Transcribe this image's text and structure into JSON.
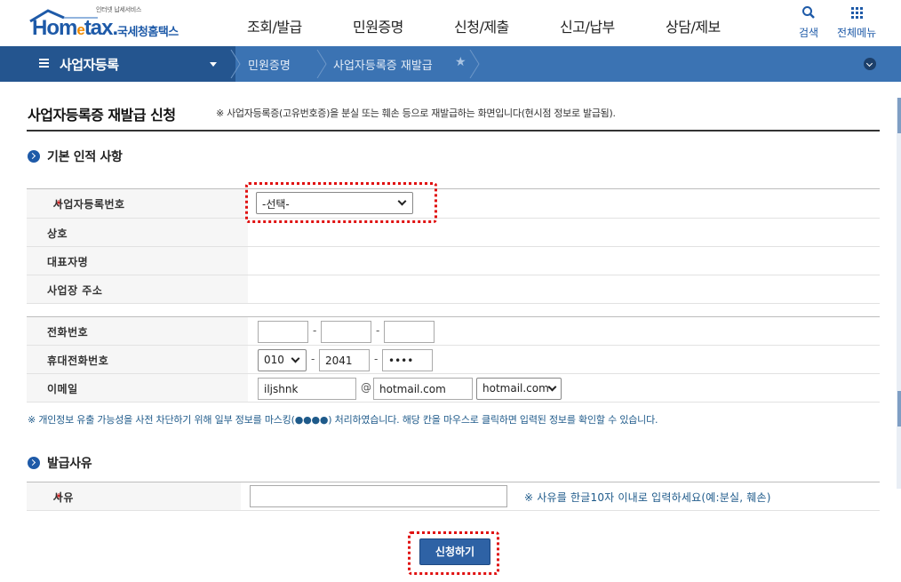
{
  "header": {
    "logo_tagline": "인터넷 납세서비스",
    "logo_word_a": "Hom",
    "logo_word_e": "e",
    "logo_word_b": "tax",
    "logo_suffix": ".",
    "logo_kr": "국세청홈택스",
    "nav": [
      "조회/발급",
      "민원증명",
      "신청/제출",
      "신고/납부",
      "상담/제보"
    ],
    "search_label": "검색",
    "allmenu_label": "전체메뉴"
  },
  "subnav": {
    "main_title": "사업자등록",
    "crumb1": "민원증명",
    "crumb2": "사업자등록증 재발급"
  },
  "page": {
    "title": "사업자등록증 재발급 신청",
    "desc": "※ 사업자등록증(고유번호증)을 분실 또는 훼손 등으로 재발급하는 화면입니다(현시점 정보로 발급됨)."
  },
  "section1": {
    "title": "기본 인적 사항",
    "req_mark": "*",
    "biz_no_label": "사업자등록번호",
    "biz_no_select": "-선택-",
    "company_label": "상호",
    "ceo_label": "대표자명",
    "address_label": "사업장 주소",
    "phone_label": "전화번호",
    "phone1": "",
    "phone2": "",
    "phone3": "",
    "mobile_label": "휴대전화번호",
    "mobile1": "010",
    "mobile2": "2041",
    "mobile3": "••••",
    "email_label": "이메일",
    "email_id": "iljshnk",
    "email_at": "@",
    "email_domain": "hotmail.com",
    "email_select": "hotmail.com",
    "dash": "-"
  },
  "privacy_note": "※ 개인정보 유출 가능성을 사전 차단하기 위해 일부 정보를 마스킹(●●●●) 처리하였습니다. 해당 칸을 마우스로 클릭하면 입력된 정보를 확인할 수 있습니다.",
  "section2": {
    "title": "발급사유",
    "req_mark": "*",
    "reason_label": "사유",
    "reason_value": "",
    "reason_note": "※ 사유를 한글10자 이내로 입력하세요(예:분실, 훼손)"
  },
  "submit_label": "신청하기",
  "colors": {
    "brand": "#1e5aa8",
    "subnav": "#3b73b3",
    "subnav_dark": "#24558f",
    "highlight": "#e01010"
  }
}
